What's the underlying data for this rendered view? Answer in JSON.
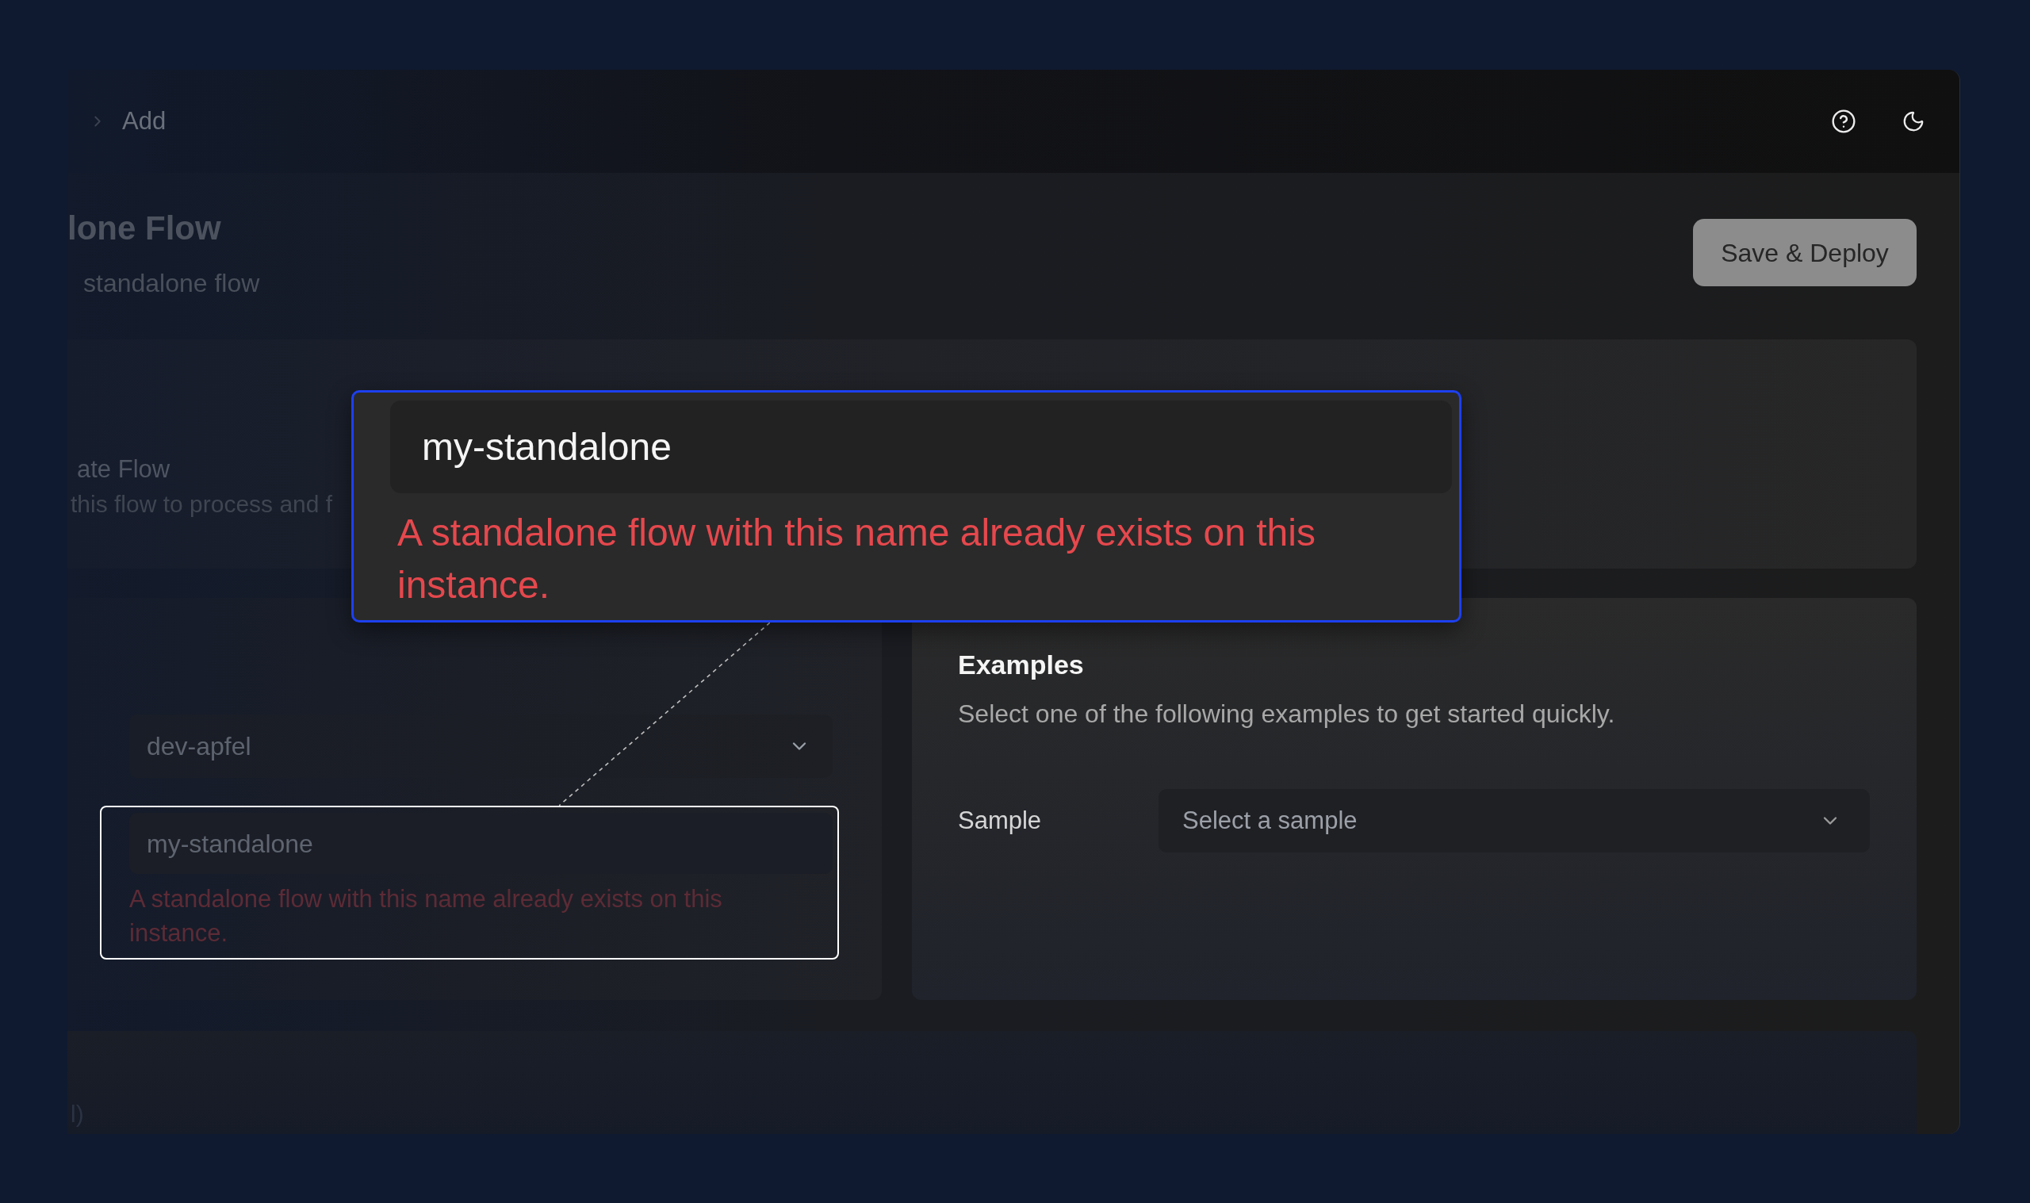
{
  "header": {
    "breadcrumb_current": "Add"
  },
  "page": {
    "title": "lone Flow",
    "subtitle": "standalone flow",
    "primary_button": "Save & Deploy"
  },
  "visibility_card": {
    "title": "ate Flow",
    "description": "this flow to process and f"
  },
  "settings_card": {
    "instance_select": {
      "value": "dev-apfel"
    },
    "name_input": {
      "value": "my-standalone",
      "error": "A standalone flow with this name already exists on this instance."
    }
  },
  "examples_card": {
    "title": "Examples",
    "description": "Select one of the following examples to get started quickly.",
    "sample_field": {
      "label": "Sample",
      "placeholder": "Select a sample"
    }
  },
  "bottom_card": {
    "text_fragment": "l)"
  },
  "zoom_callout": {
    "name_value": "my-standalone",
    "error": "A standalone flow with this name already exists on this instance."
  }
}
